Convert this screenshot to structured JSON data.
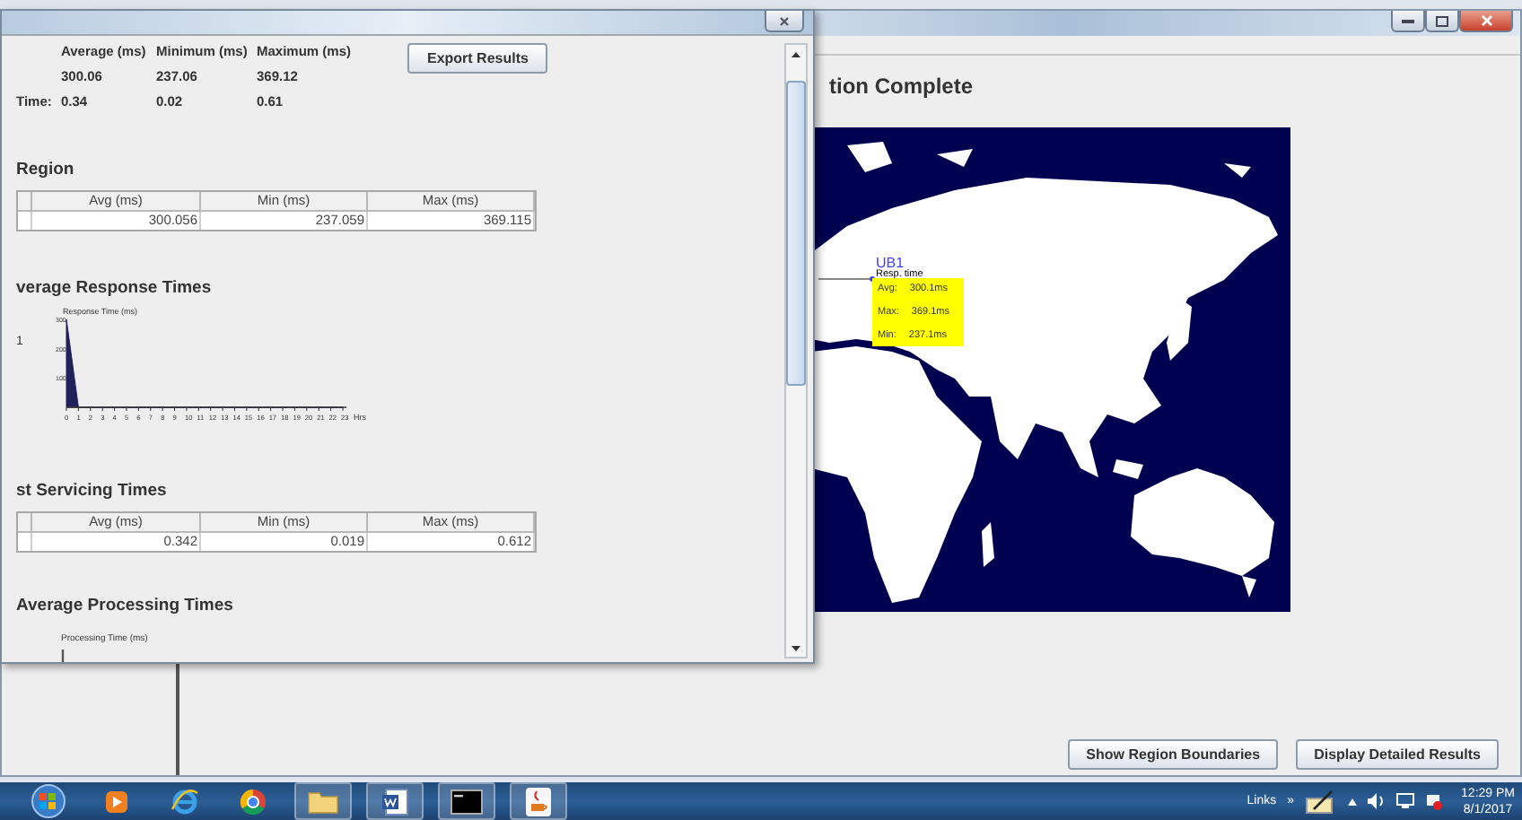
{
  "main_window": {
    "heading": "tion Complete",
    "map": {
      "region_label": "UB1",
      "tooltip": {
        "title": "Resp. time",
        "rows": [
          {
            "label": "Avg:",
            "value": "300.1ms"
          },
          {
            "label": "Max:",
            "value": "369.1ms"
          },
          {
            "label": "Min:",
            "value": "237.1ms"
          }
        ]
      }
    },
    "buttons": [
      "Show Region Boundaries",
      "Display Detailed Results"
    ]
  },
  "dialog": {
    "export_button": "Export Results",
    "summary": {
      "columns": [
        "Average (ms)",
        "Minimum (ms)",
        "Maximum (ms)"
      ],
      "rows": [
        {
          "values": [
            "300.06",
            "237.06",
            "369.12"
          ]
        },
        {
          "label": "Time:",
          "values": [
            "0.34",
            "0.02",
            "0.61"
          ]
        }
      ]
    },
    "sections": [
      {
        "kind": "table",
        "title": "Region",
        "columns": [
          "Avg (ms)",
          "Min (ms)",
          "Max (ms)"
        ],
        "rows": [
          [
            "300.056",
            "237.059",
            "369.115"
          ]
        ]
      },
      {
        "kind": "chart",
        "title": "verage Response Times",
        "side_label": "1",
        "chart_data": {
          "type": "area",
          "ylabel": "Response Time (ms)",
          "xlabel": "Hrs",
          "x": [
            0,
            1,
            2,
            3,
            4,
            5,
            6,
            7,
            8,
            9,
            10,
            11,
            12,
            13,
            14,
            15,
            16,
            17,
            18,
            19,
            20,
            21,
            22,
            23
          ],
          "values": [
            300,
            0,
            0,
            0,
            0,
            0,
            0,
            0,
            0,
            0,
            0,
            0,
            0,
            0,
            0,
            0,
            0,
            0,
            0,
            0,
            0,
            0,
            0,
            0
          ],
          "xlim": [
            0,
            23
          ],
          "ylim": [
            0,
            300
          ],
          "yticks": [
            100,
            200,
            300
          ],
          "xticks": [
            0,
            1,
            2,
            3,
            4,
            5,
            6,
            7,
            8,
            9,
            10,
            11,
            12,
            13,
            14,
            15,
            16,
            17,
            18,
            19,
            20,
            21,
            22,
            23
          ]
        }
      },
      {
        "kind": "table",
        "title": "st Servicing Times",
        "columns": [
          "Avg (ms)",
          "Min (ms)",
          "Max (ms)"
        ],
        "rows": [
          [
            "0.342",
            "0.019",
            "0.612"
          ]
        ]
      },
      {
        "kind": "axis",
        "title": "Average Processing Times",
        "chart_label": "Processing Time (ms)"
      }
    ]
  },
  "taskbar": {
    "links": "Links",
    "chevron": "»",
    "time": "12:29 PM",
    "date": "8/1/2017"
  }
}
